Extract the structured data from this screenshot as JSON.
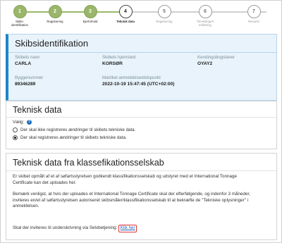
{
  "stepper": {
    "steps": [
      {
        "num": "1",
        "label": "Skibs-\nidentifikation",
        "state": "done"
      },
      {
        "num": "2",
        "label": "Registrering",
        "state": "done"
      },
      {
        "num": "3",
        "label": "Ejerforhold",
        "state": "done"
      },
      {
        "num": "4",
        "label": "Teknisk data",
        "state": "active"
      },
      {
        "num": "5",
        "label": "Registrering",
        "state": "todo"
      },
      {
        "num": "6",
        "label": "Tilmeldinger/\nerklæring",
        "state": "todo"
      },
      {
        "num": "7",
        "label": "Resumé",
        "state": "todo"
      }
    ],
    "done_color": "#9ab66a"
  },
  "ship_ident": {
    "title": "Skibsidentifikation",
    "fields": {
      "name_label": "Skibets navn",
      "name_value": "CARLA",
      "home_label": "Skibets hjemsted",
      "home_value": "KORSØR",
      "callsign_label": "Kendingsbogstaver",
      "callsign_value": "OYAY2",
      "build_label": "Byggenummer",
      "build_value": "89346289",
      "date_label": "Matrikel anmeldelsestidspunkt",
      "date_value": "2022-10-19 15:47:45 (UTC+02:00)"
    },
    "accent_color": "#1f85c7"
  },
  "tech_data": {
    "title": "Teknisk data",
    "choose_label": "Vælg:",
    "options": [
      {
        "label": "Der skal ikke registreres ændringer til skibets tekniske data.",
        "checked": false
      },
      {
        "label": "Der skal registreres ændringer til skibets tekniske data.",
        "checked": true
      }
    ]
  },
  "class_data": {
    "title": "Teknisk data fra klassefikationsselskab",
    "para1": "Er skibet opmålt af et af søfartsstyrelsen godkendt klassifikationsselskab og udstyret med et International Tonnage Certificate kan det uploades her.",
    "para2": "Bemærk venligst, at hvis der uploades et International Tonnage Certificate skal der efterfølgende, og indenfor 3 måneder, inviteres en/et af søfartsstyrelsen autoriseret skibsmåler/klassifikationsselskab til at bekræfte de \"Tekniske oplysninger\" i anmeldelsen.",
    "invite_text": "Skal der inviteres til underskrivning via Selvbetjening:",
    "invite_link": "Klik her",
    "highlight_color": "#e53030"
  }
}
